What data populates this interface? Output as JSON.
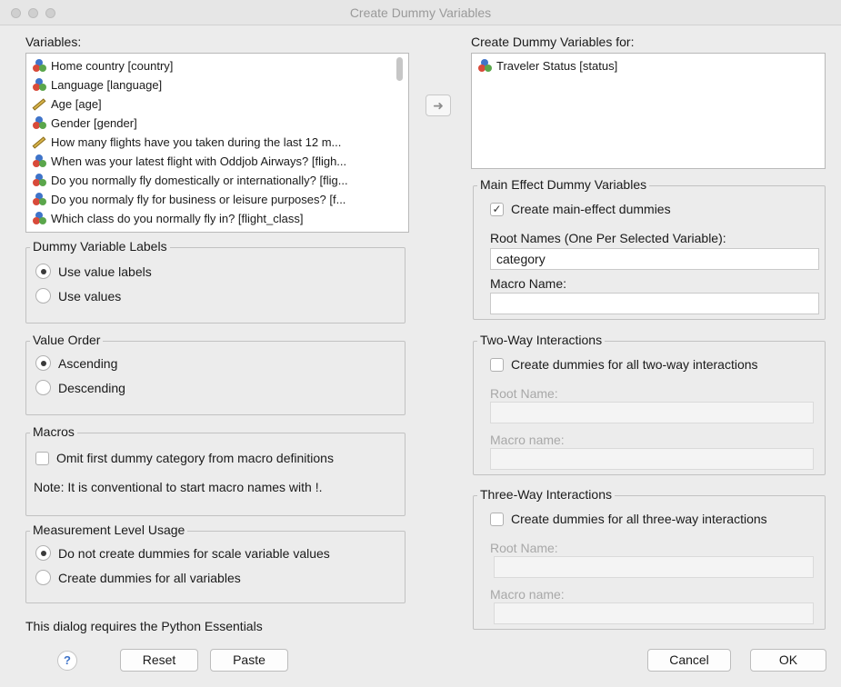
{
  "window": {
    "title": "Create Dummy Variables"
  },
  "variables": {
    "label": "Variables:",
    "items": [
      {
        "text": "Home country [country]",
        "icon": "nominal-icon"
      },
      {
        "text": "Language [language]",
        "icon": "nominal-icon"
      },
      {
        "text": "Age [age]",
        "icon": "scale-icon"
      },
      {
        "text": "Gender [gender]",
        "icon": "nominal-icon"
      },
      {
        "text": "How many flights have you taken during the last 12 m...",
        "icon": "scale-icon"
      },
      {
        "text": "When was your latest flight with Oddjob Airways? [fligh...",
        "icon": "nominal-icon"
      },
      {
        "text": "Do you normally fly domestically or internationally? [flig...",
        "icon": "nominal-icon"
      },
      {
        "text": "Do you normaly fly for business or leisure purposes? [f...",
        "icon": "nominal-icon"
      },
      {
        "text": "Which class do you normally fly in? [flight_class]",
        "icon": "nominal-icon"
      }
    ]
  },
  "move_button": {
    "icon": "arrow-right-icon"
  },
  "selected": {
    "label": "Create Dummy Variables for:",
    "items": [
      {
        "text": "Traveler Status [status]",
        "icon": "nominal-icon"
      }
    ]
  },
  "dummy_labels": {
    "title": "Dummy Variable Labels",
    "options": [
      "Use value labels",
      "Use values"
    ],
    "selected_index": 0
  },
  "value_order": {
    "title": "Value Order",
    "options": [
      "Ascending",
      "Descending"
    ],
    "selected_index": 0
  },
  "macros": {
    "title": "Macros",
    "omit_label": "Omit first dummy category from macro definitions",
    "omit_checked": false,
    "note": "Note: It is conventional to start macro names with !."
  },
  "measurement": {
    "title": "Measurement Level Usage",
    "options": [
      "Do not create dummies for scale variable values",
      "Create dummies for all variables"
    ],
    "selected_index": 0
  },
  "footer_note": "This dialog requires the Python Essentials",
  "main_effect": {
    "title": "Main Effect Dummy Variables",
    "create_label": "Create main-effect dummies",
    "create_checked": true,
    "root_label": "Root Names (One Per Selected Variable):",
    "root_value": "category",
    "macro_label": "Macro Name:",
    "macro_value": ""
  },
  "two_way": {
    "title": "Two-Way Interactions",
    "create_label": "Create dummies for all two-way interactions",
    "create_checked": false,
    "root_label": "Root Name:",
    "macro_label": "Macro name:"
  },
  "three_way": {
    "title": "Three-Way Interactions",
    "create_label": "Create dummies for all three-way interactions",
    "create_checked": false,
    "root_label": "Root Name:",
    "macro_label": "Macro name:"
  },
  "buttons": {
    "help": "?",
    "reset": "Reset",
    "paste": "Paste",
    "cancel": "Cancel",
    "ok": "OK"
  }
}
